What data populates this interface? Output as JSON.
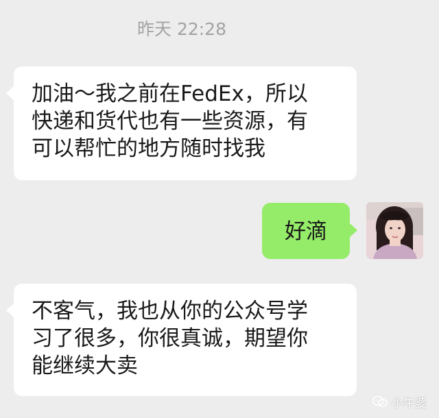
{
  "timestamp": "昨天 22:28",
  "messages": [
    {
      "sender": "contact",
      "text": "加油～我之前在FedEx，所以\n快递和货代也有一些资源，有\n可以帮忙的地方随时找我"
    },
    {
      "sender": "me",
      "text": "好滴"
    },
    {
      "sender": "contact",
      "text": "不客气，我也从你的公众号学\n习了很多，你很真诚，期望你\n能继续大卖"
    }
  ],
  "watermark": {
    "text": "小牛婆",
    "icon": "wechat-official-account-icon"
  },
  "colors": {
    "background": "#ededed",
    "incoming_bubble": "#ffffff",
    "outgoing_bubble": "#95ec69",
    "timestamp_text": "#a3a3a3"
  }
}
